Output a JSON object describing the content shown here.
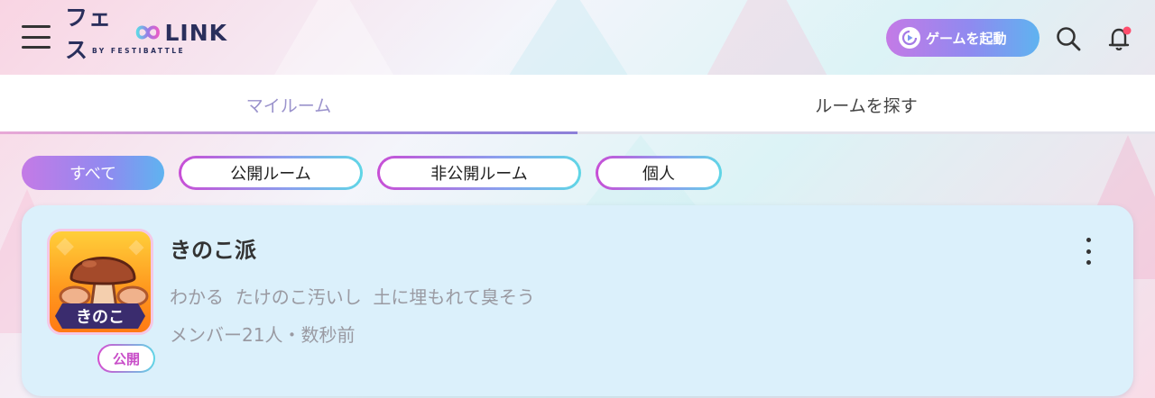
{
  "header": {
    "logo_text": "フェス∞LINK",
    "logo_sub": "BY FESTIBATTLE",
    "launch_game_label": "ゲームを起動"
  },
  "tabs": [
    {
      "label": "マイルーム",
      "active": true
    },
    {
      "label": "ルームを探す",
      "active": false
    }
  ],
  "filters": [
    {
      "label": "すべて",
      "active": true
    },
    {
      "label": "公開ルーム",
      "active": false
    },
    {
      "label": "非公開ルーム",
      "active": false
    },
    {
      "label": "個人",
      "active": false
    }
  ],
  "rooms": [
    {
      "title": "きのこ派",
      "icon_label": "きのこ",
      "last_message": "わかる  たけのこ汚いし  土に埋もれて臭そう",
      "meta": "メンバー21人・数秒前",
      "visibility_badge": "公開"
    }
  ],
  "colors": {
    "accent_gradient_start": "#c47ae6",
    "accent_gradient_end": "#5fb3f0",
    "card_bg": "#dbf0fb",
    "notification_dot": "#ff4d6d"
  },
  "icons": {
    "menu": "hamburger-icon",
    "launch": "play-circle-icon",
    "search": "search-icon",
    "notification": "bell-icon",
    "more": "more-vertical-icon"
  }
}
